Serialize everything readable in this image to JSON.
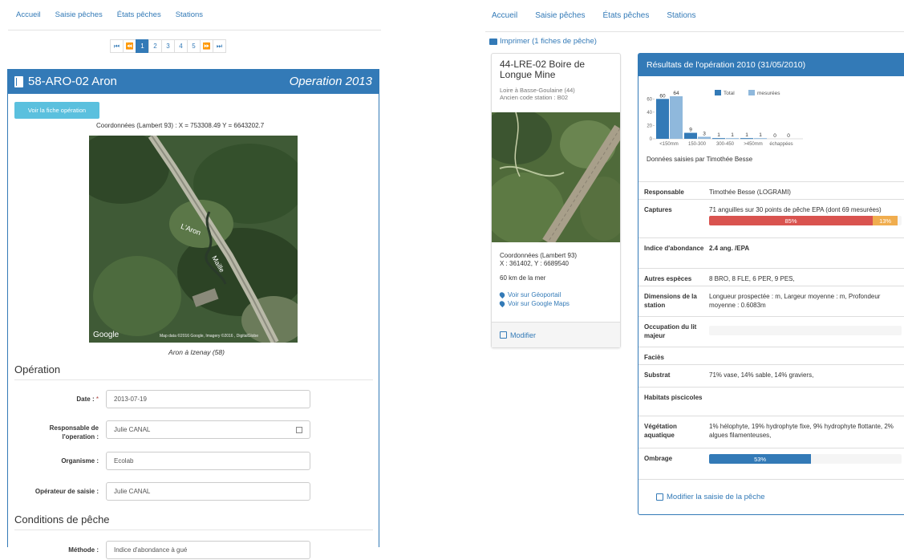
{
  "left": {
    "nav": [
      "Accueil",
      "Saisie pêches",
      "États pêches",
      "Stations"
    ],
    "pager": [
      "⏮",
      "⏪",
      "1",
      "2",
      "3",
      "4",
      "5",
      "⏩",
      "⏭"
    ],
    "station_title": "58-ARO-02 Aron",
    "operation_title": "Operation 2013",
    "btn_fiche": "Voir la fiche opération",
    "coords": "Coordonnées (Lambert 93) : X = 753308.49 Y = 6643202.7",
    "map": {
      "label1": "L'Aron",
      "label2": "Maille",
      "brand": "Google",
      "credit": "Map data ©2016 Google, Imagery ©2016 , DigitalGlobe"
    },
    "caption": "Aron à Izenay (58)",
    "section_operation": "Opération",
    "fields": [
      {
        "label": "Date :",
        "required": "*",
        "value": "2013-07-19"
      },
      {
        "label": "Responsable de l'operation :",
        "value": "Julie CANAL"
      },
      {
        "label": "Organisme :",
        "value": "Ecolab"
      },
      {
        "label": "Opérateur de saisie :",
        "value": "Julie CANAL"
      }
    ],
    "section_conditions": "Conditions de pêche",
    "method_label": "Méthode :",
    "method_value": "Indice d'abondance à gué"
  },
  "right": {
    "nav": [
      "Accueil",
      "Saisie pêches",
      "États pêches",
      "Stations"
    ],
    "print_link": "Imprimer (1 fiches de pêche)",
    "station": {
      "name": "44-LRE-02 Boire de Longue Mine",
      "location": "Loire à Basse-Goulaine (44)",
      "old_code": "Ancien code station : B02",
      "coords_label": "Coordonnées (Lambert 93)",
      "coords_value": "X : 361402, Y : 6689540",
      "sea_distance": "60 km de la mer",
      "link_geoportail": "Voir sur Géoportail",
      "link_gmaps": "Voir sur Google Maps",
      "modify": "Modifier"
    },
    "results_title": "Résultats de l'opération 2010 (31/05/2010)",
    "saisie_by": "Données saisies par Timothée Besse",
    "table": [
      {
        "k": "Responsable",
        "v": "Timothée Besse (LOGRAMI)"
      },
      {
        "k": "Captures",
        "v": "71 anguilles sur 30 points de pêche EPA (dont 69 mesurées)"
      },
      {
        "k": "Indice d'abondance",
        "v": "2.4 ang. /EPA"
      },
      {
        "k": "Autres espèces",
        "v": "8 BRO, 8 FLE, 6 PER, 9 PES,"
      },
      {
        "k": "Dimensions de la station",
        "v": "Longueur prospectée : m, Largeur moyenne : m, Profondeur moyenne : 0.6083m"
      },
      {
        "k": "Occupation du lit majeur",
        "v": ""
      },
      {
        "k": "Faciès",
        "v": ""
      },
      {
        "k": "Substrat",
        "v": "71% vase, 14% sable, 14% graviers,"
      },
      {
        "k": "Habitats piscicoles",
        "v": ""
      },
      {
        "k": "Végétation aquatique",
        "v": "1% hélophyte, 19% hydrophyte fixe, 9% hydrophyte flottante, 2% algues filamenteuses,"
      },
      {
        "k": "Ombrage",
        "v": ""
      }
    ],
    "captures_bar": {
      "red_pct": 85,
      "orange_pct": 13,
      "red_label": "85%",
      "orange_label": "13%",
      "red": "#d9534f",
      "orange": "#f0ad4e"
    },
    "ombrage_bar": {
      "pct": 53,
      "label": "53%",
      "color": "#337ab7"
    },
    "modify_footer": "Modifier la saisie de la pêche"
  },
  "chart_data": {
    "type": "bar",
    "categories": [
      "<150mm",
      "150-300",
      "300-450",
      ">450mm",
      "échappées"
    ],
    "series": [
      {
        "name": "Total",
        "values": [
          60,
          9,
          1,
          1,
          0
        ],
        "color": "#337ab7"
      },
      {
        "name": "mesurées",
        "values": [
          64,
          3,
          1,
          1,
          0
        ],
        "color": "#8fb8dc"
      }
    ],
    "yticks": [
      "0",
      "20",
      "40",
      "60"
    ],
    "ylim": [
      0,
      70
    ],
    "legend": "top",
    "grid": false
  }
}
